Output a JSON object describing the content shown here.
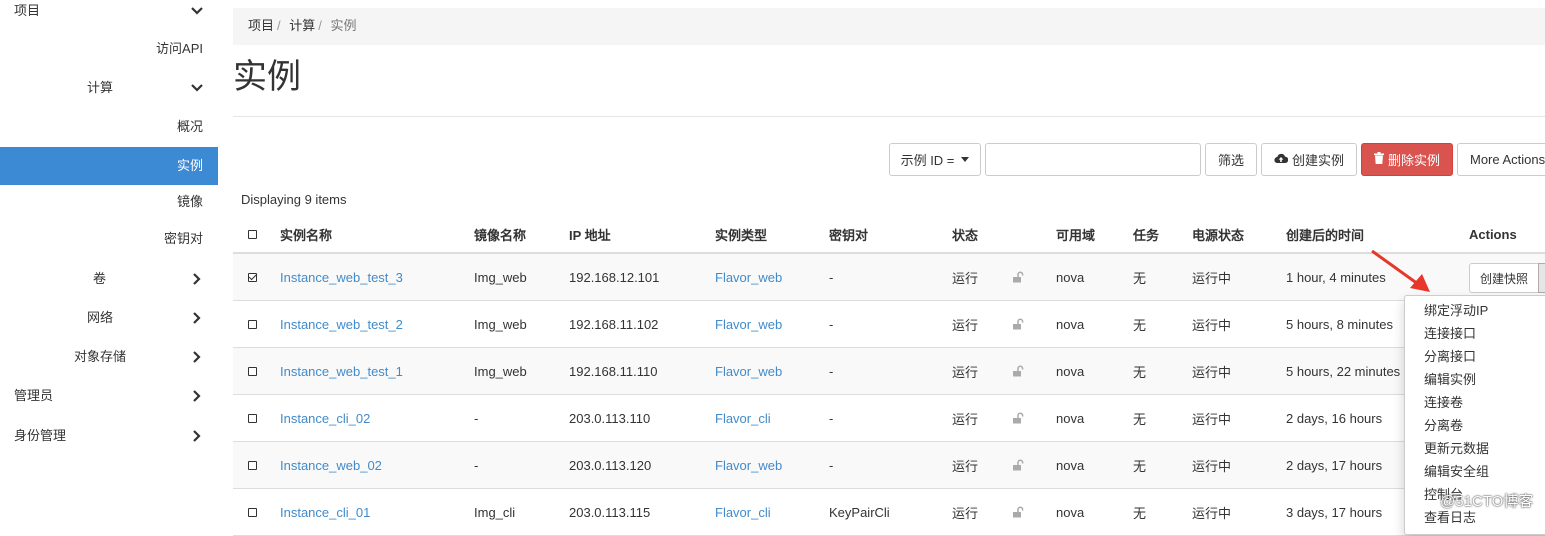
{
  "sidebar": {
    "project": "项目",
    "api_access": "访问API",
    "compute": "计算",
    "overview": "概况",
    "instances": "实例",
    "images": "镜像",
    "keypairs": "密钥对",
    "volumes": "卷",
    "network": "网络",
    "object_store": "对象存储",
    "admin": "管理员",
    "identity": "身份管理"
  },
  "breadcrumb": {
    "items": [
      "项目",
      "计算",
      "实例"
    ]
  },
  "page_title": "实例",
  "toolbar": {
    "filter_field": "示例 ID =",
    "search_value": "",
    "filter_button": "筛选",
    "create_button": "创建实例",
    "delete_button": "删除实例",
    "more_actions": "More Actions"
  },
  "count_text": "Displaying 9 items",
  "table": {
    "headers": [
      "实例名称",
      "镜像名称",
      "IP 地址",
      "实例类型",
      "密钥对",
      "状态",
      "可用域",
      "任务",
      "电源状态",
      "创建后的时间",
      "Actions"
    ],
    "rows": [
      {
        "name": "Instance_web_test_3",
        "image": "Img_web",
        "ip": "192.168.12.101",
        "flavor": "Flavor_web",
        "keypair": "-",
        "status": "运行",
        "az": "nova",
        "task": "无",
        "power": "运行中",
        "age": "1 hour, 4 minutes",
        "checked": true
      },
      {
        "name": "Instance_web_test_2",
        "image": "Img_web",
        "ip": "192.168.11.102",
        "flavor": "Flavor_web",
        "keypair": "-",
        "status": "运行",
        "az": "nova",
        "task": "无",
        "power": "运行中",
        "age": "5 hours, 8 minutes",
        "checked": false
      },
      {
        "name": "Instance_web_test_1",
        "image": "Img_web",
        "ip": "192.168.11.110",
        "flavor": "Flavor_web",
        "keypair": "-",
        "status": "运行",
        "az": "nova",
        "task": "无",
        "power": "运行中",
        "age": "5 hours, 22 minutes",
        "checked": false
      },
      {
        "name": "Instance_cli_02",
        "image": "-",
        "ip": "203.0.113.110",
        "flavor": "Flavor_cli",
        "keypair": "-",
        "status": "运行",
        "az": "nova",
        "task": "无",
        "power": "运行中",
        "age": "2 days, 16 hours",
        "checked": false
      },
      {
        "name": "Instance_web_02",
        "image": "-",
        "ip": "203.0.113.120",
        "flavor": "Flavor_web",
        "keypair": "-",
        "status": "运行",
        "az": "nova",
        "task": "无",
        "power": "运行中",
        "age": "2 days, 17 hours",
        "checked": false
      },
      {
        "name": "Instance_cli_01",
        "image": "Img_cli",
        "ip": "203.0.113.115",
        "flavor": "Flavor_cli",
        "keypair": "KeyPairCli",
        "status": "运行",
        "az": "nova",
        "task": "无",
        "power": "运行中",
        "age": "3 days, 17 hours",
        "checked": false
      }
    ]
  },
  "row_action": "创建快照",
  "dropdown": [
    "绑定浮动IP",
    "连接接口",
    "分离接口",
    "编辑实例",
    "连接卷",
    "分离卷",
    "更新元数据",
    "编辑安全组",
    "控制台",
    "查看日志"
  ],
  "watermark": "@51CTO博客",
  "colors": {
    "primary": "#3d8ad4",
    "link": "#428bca",
    "danger": "#d9534f",
    "arrow": "#e8362a"
  }
}
